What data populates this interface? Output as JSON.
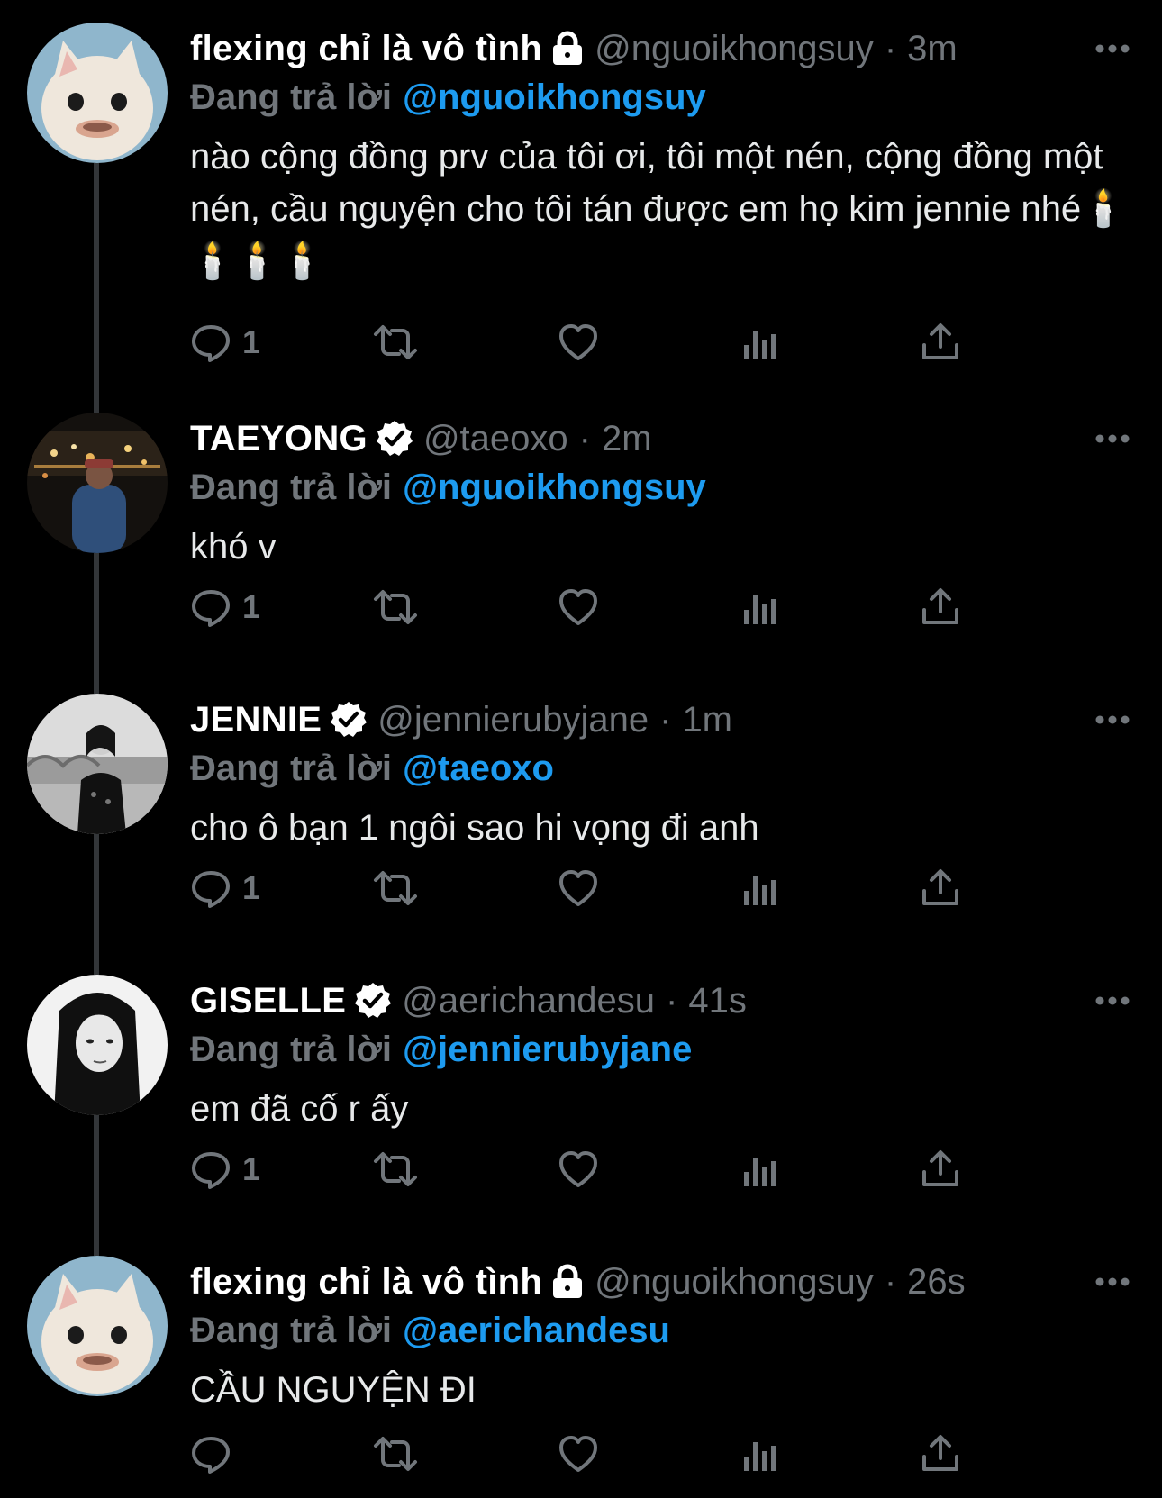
{
  "tweets": [
    {
      "display_name": "flexing chỉ là vô tình",
      "badge": "lock-icon",
      "handle": "@nguoikhongsuy",
      "sep": "·",
      "time": "3m",
      "reply_label": "Đang trả lời",
      "reply_to": "@nguoikhongsuy",
      "text": "nào cộng đồng prv của tôi ơi, tôi một nén, cộng đồng một nén, cầu nguyện cho tôi tán được em họ kim jennie nhé🕯️🕯️🕯️🕯️",
      "reply_count": "1",
      "avatar": "cat-avatar"
    },
    {
      "display_name": "TAEYONG",
      "badge": "verified-icon",
      "handle": "@taeoxo",
      "sep": "·",
      "time": "2m",
      "reply_label": "Đang trả lời",
      "reply_to": "@nguoikhongsuy",
      "text": "khó v",
      "reply_count": "1",
      "avatar": "night-photo-avatar"
    },
    {
      "display_name": "JENNIE",
      "badge": "verified-icon",
      "handle": "@jennierubyjane",
      "sep": "·",
      "time": "1m",
      "reply_label": "Đang trả lời",
      "reply_to": "@taeoxo",
      "text": "cho ô bạn 1 ngôi sao hi vọng đi anh",
      "reply_count": "1",
      "avatar": "bw-portrait-avatar"
    },
    {
      "display_name": "GISELLE",
      "badge": "verified-icon",
      "handle": "@aerichandesu",
      "sep": "·",
      "time": "41s",
      "reply_label": "Đang trả lời",
      "reply_to": "@jennierubyjane",
      "text": "em đã cố r ấy",
      "reply_count": "1",
      "avatar": "bw-closeup-avatar"
    },
    {
      "display_name": "flexing chỉ là vô tình",
      "badge": "lock-icon",
      "handle": "@nguoikhongsuy",
      "sep": "·",
      "time": "26s",
      "reply_label": "Đang trả lời",
      "reply_to": "@aerichandesu",
      "text": "CẦU NGUYỆN ĐI",
      "reply_count": "",
      "avatar": "cat-avatar"
    }
  ],
  "colors": {
    "background": "#000000",
    "muted": "#71767b",
    "accent": "#1d9bf0",
    "thread_line": "#333639"
  },
  "action_icons": [
    "reply-icon",
    "retweet-icon",
    "like-icon",
    "views-icon",
    "share-icon"
  ]
}
